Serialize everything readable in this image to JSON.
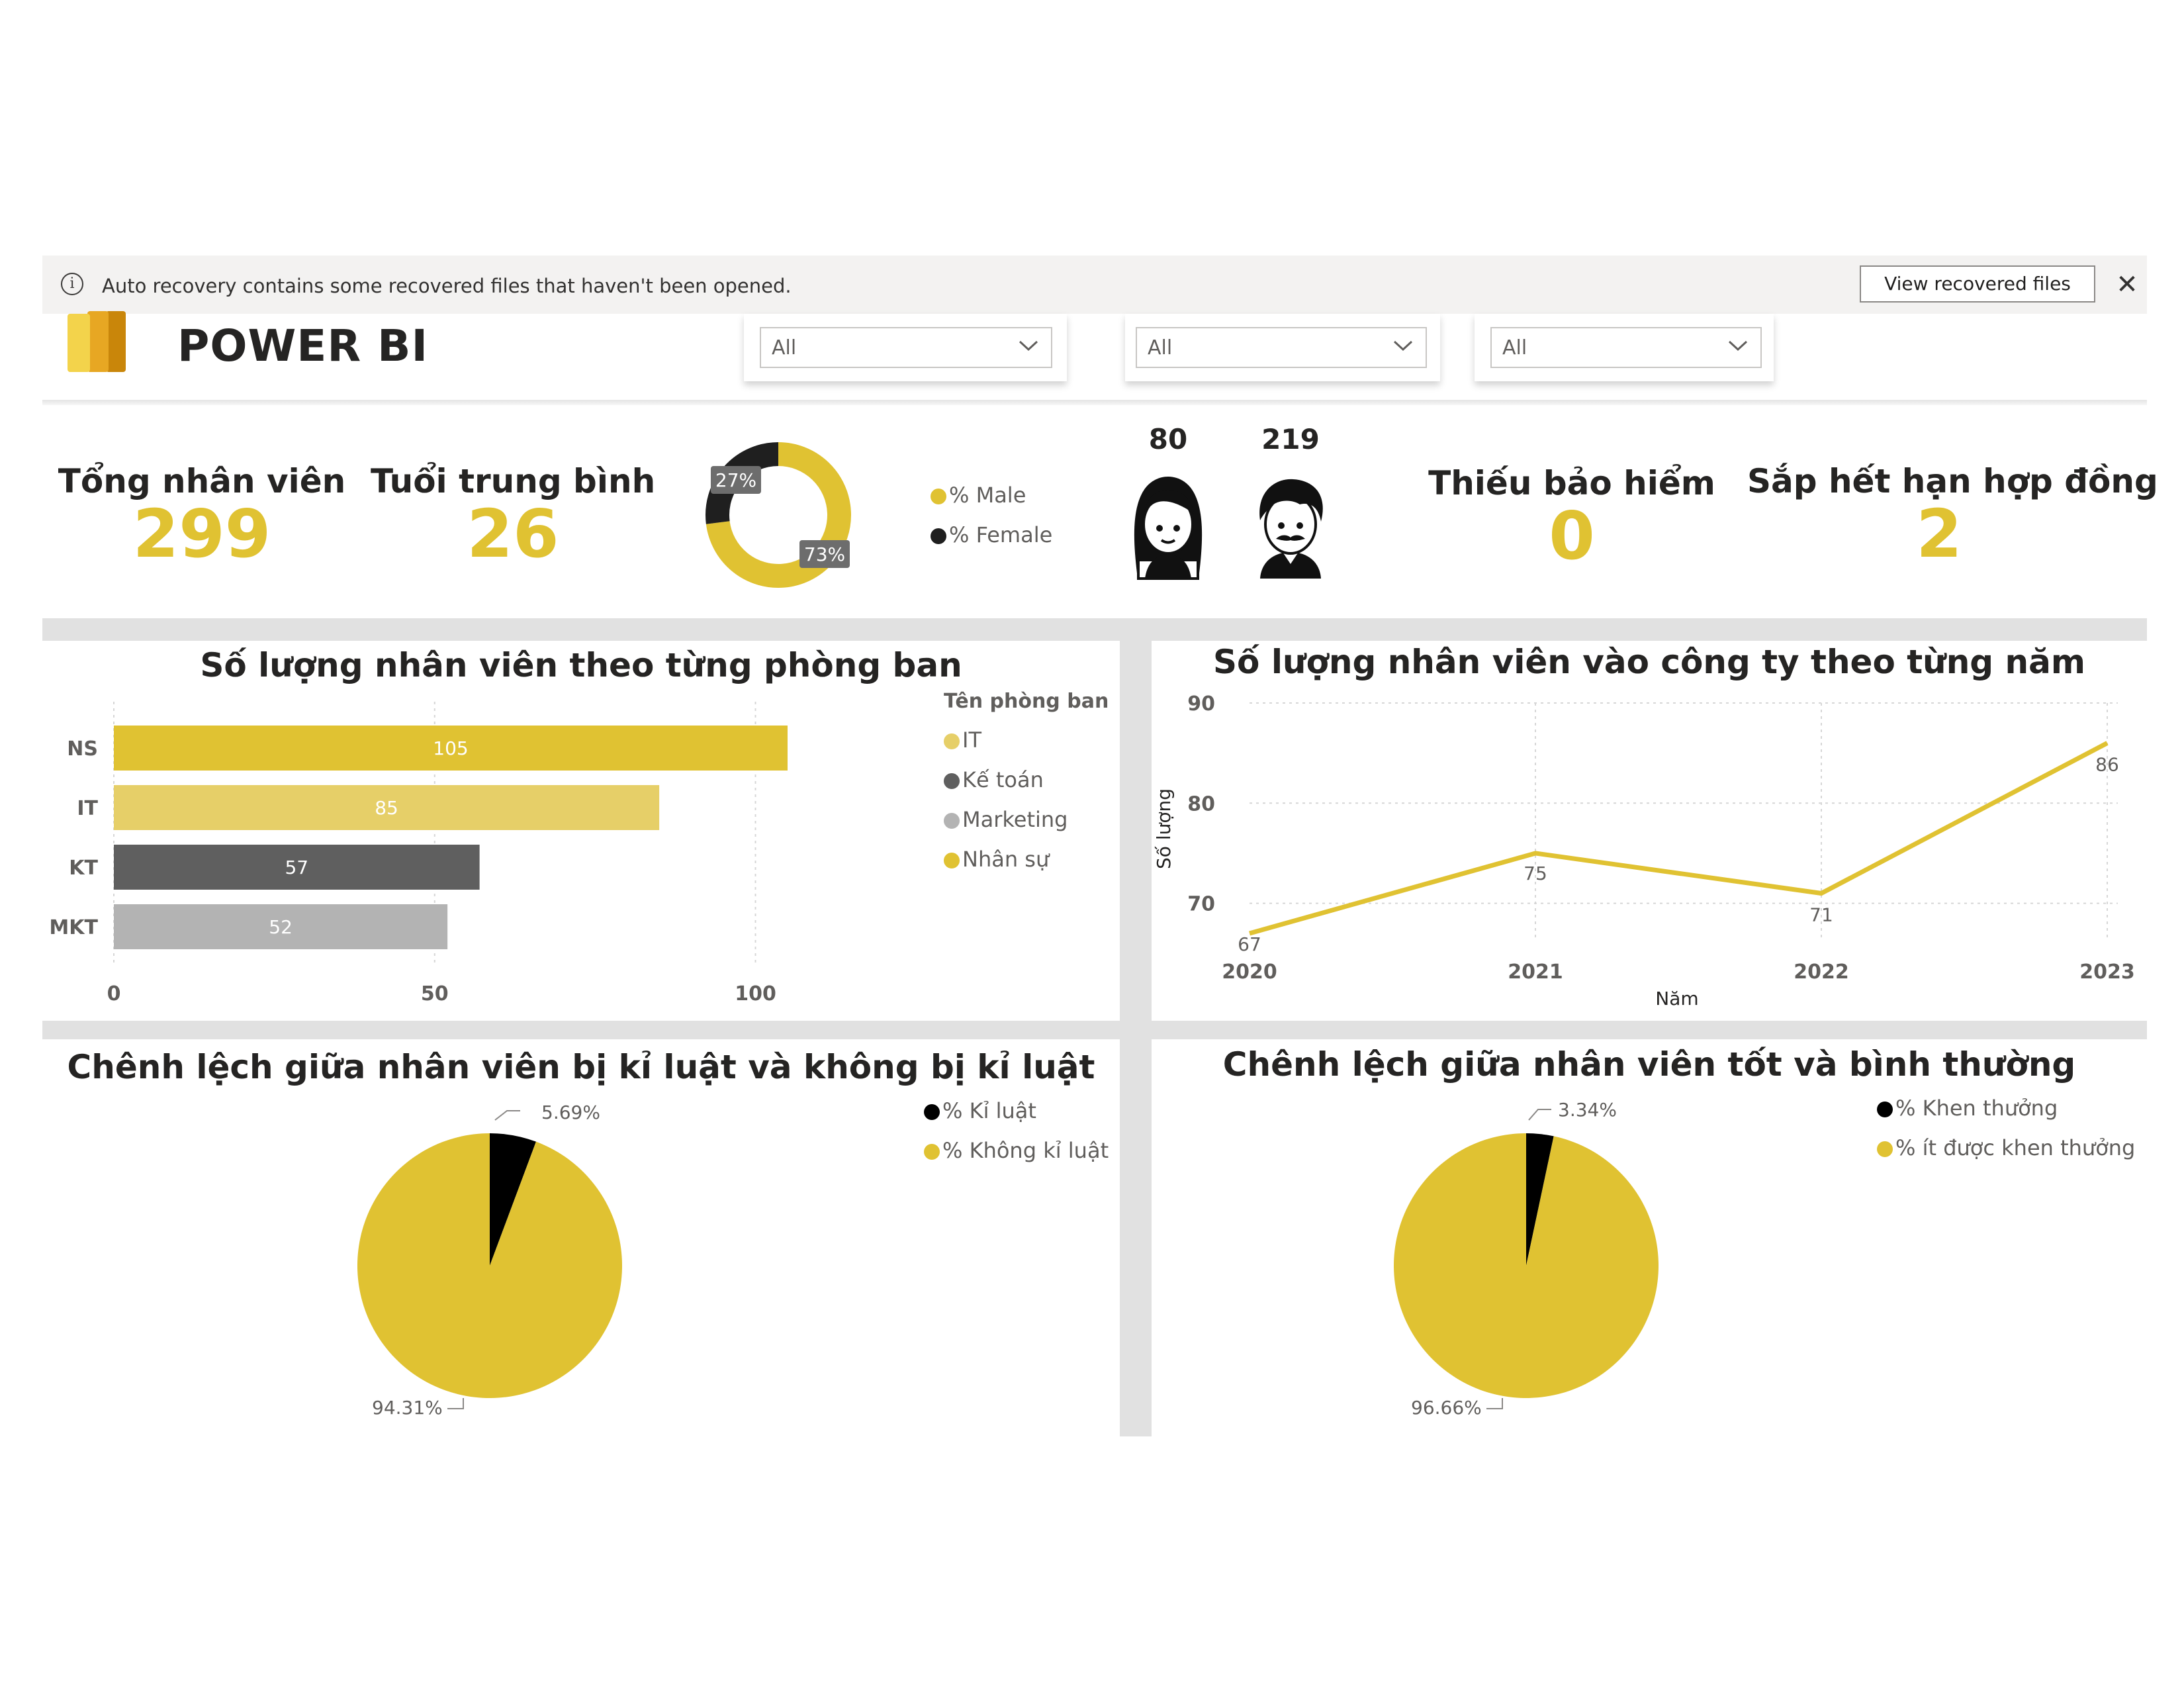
{
  "notification": {
    "text": "Auto recovery contains some recovered files that haven't been opened.",
    "button": "View recovered files",
    "close": "✕",
    "info": "i"
  },
  "header": {
    "title": "POWER BI",
    "slicers": [
      {
        "value": "All"
      },
      {
        "value": "All"
      },
      {
        "value": "All"
      }
    ]
  },
  "kpis": {
    "total_employees": {
      "label": "Tổng nhân viên",
      "value": "299"
    },
    "avg_age": {
      "label": "Tuổi trung bình",
      "value": "26"
    },
    "missing_insurance": {
      "label": "Thiếu bảo hiểm",
      "value": "0"
    },
    "contract_expiring": {
      "label": "Sắp hết hạn hợp đồng",
      "value": "2"
    },
    "female_count": "80",
    "male_count": "219"
  },
  "gender_donut": {
    "male_pct_label": "73%",
    "female_pct_label": "27%",
    "legend": [
      "% Male",
      "% Female"
    ],
    "colors": {
      "male": "#e0c232",
      "female": "#1f1f1f"
    }
  },
  "chart_data": [
    {
      "type": "bar",
      "title": "Số lượng nhân viên theo từng phòng ban",
      "categories": [
        "NS",
        "IT",
        "KT",
        "MKT"
      ],
      "values": [
        105,
        85,
        57,
        52
      ],
      "colors": [
        "#e0c232",
        "#e6cf68",
        "#5f5f5f",
        "#b3b3b3"
      ],
      "xlim": [
        0,
        105
      ],
      "xticks": [
        "0",
        "50",
        "100"
      ],
      "legend_title": "Tên phòng ban",
      "legend": [
        "IT",
        "Kế toán",
        "Marketing",
        "Nhân sự"
      ],
      "legend_colors": [
        "#e6cf68",
        "#5f5f5f",
        "#b3b3b3",
        "#e0c232"
      ]
    },
    {
      "type": "line",
      "title": "Số lượng nhân viên vào công ty theo từng năm",
      "x": [
        "2020",
        "2021",
        "2022",
        "2023"
      ],
      "values": [
        67,
        75,
        71,
        86
      ],
      "xlabel": "Năm",
      "ylabel": "Số lượng",
      "ylim": [
        67,
        90
      ],
      "yticks": [
        "70",
        "80",
        "90"
      ],
      "color": "#e0c232"
    },
    {
      "type": "pie",
      "title": "Chênh lệch giữa nhân viên bị kỉ luật và không bị kỉ luật",
      "labels": [
        "% Kỉ luật",
        "% Không kỉ luật"
      ],
      "values": [
        5.69,
        94.31
      ],
      "value_labels": [
        "5.69%",
        "94.31%"
      ],
      "colors": [
        "#000000",
        "#e0c232"
      ]
    },
    {
      "type": "pie",
      "title": "Chênh lệch giữa nhân viên tốt và bình thường",
      "labels": [
        "% Khen thưởng",
        "% ít được khen thưởng"
      ],
      "values": [
        3.34,
        96.66
      ],
      "value_labels": [
        "3.34%",
        "96.66%"
      ],
      "colors": [
        "#000000",
        "#e0c232"
      ]
    }
  ]
}
